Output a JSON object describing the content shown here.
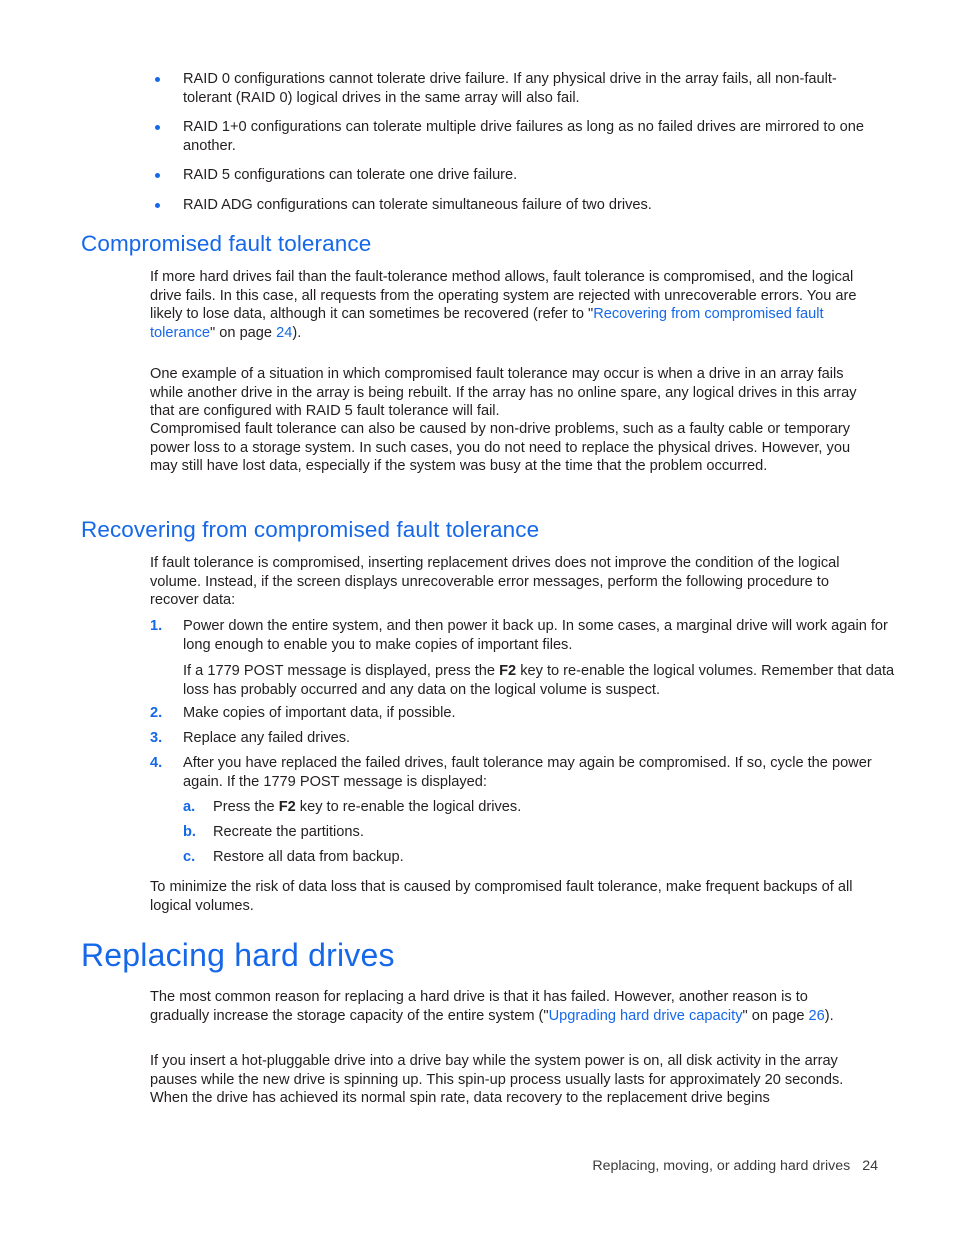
{
  "document": {
    "page_number": "24",
    "footer_chapter": "Replacing, moving, or adding hard drives"
  },
  "bullets": [
    "RAID 0 configurations cannot tolerate drive failure. If any physical drive in the array fails, all non-fault-tolerant (RAID 0) logical drives in the same array will also fail.",
    "RAID 1+0 configurations can tolerate multiple drive failures as long as no failed drives are mirrored to one another.",
    "RAID 5 configurations can tolerate one drive failure.",
    "RAID ADG configurations can tolerate simultaneous failure of two drives."
  ],
  "section_compromised": {
    "heading": "Compromised fault tolerance",
    "para1_a": "If more hard drives fail than the fault-tolerance method allows, fault tolerance is compromised, and the logical drive fails. In this case, all requests from the operating system are rejected with unrecoverable errors. You are likely to lose data, although it can sometimes be recovered (refer to \"",
    "para1_link": "Recovering from compromised fault tolerance",
    "para1_b": "\" on page ",
    "para1_page": "24",
    "para1_c": ").",
    "para2": "One example of a situation in which compromised fault tolerance may occur is when a drive in an array fails while another drive in the array is being rebuilt. If the array has no online spare, any logical drives in this array that are configured with RAID 5 fault tolerance will fail.",
    "para3": "Compromised fault tolerance can also be caused by non-drive problems, such as a faulty cable or temporary power loss to a storage system. In such cases, you do not need to replace the physical drives. However, you may still have lost data, especially if the system was busy at the time that the problem occurred."
  },
  "section_recovering": {
    "heading": "Recovering from compromised fault tolerance",
    "intro": "If fault tolerance is compromised, inserting replacement drives does not improve the condition of the logical volume. Instead, if the screen displays unrecoverable error messages, perform the following procedure to recover data:",
    "steps": [
      {
        "marker": "1.",
        "text": "Power down the entire system, and then power it back up. In some cases, a marginal drive will work again for long enough to enable you to make copies of important files."
      },
      {
        "marker": "2.",
        "text": "Make copies of important data, if possible."
      },
      {
        "marker": "3.",
        "text": "Replace any failed drives."
      },
      {
        "marker": "4.",
        "text": "After you have replaced the failed drives, fault tolerance may again be compromised. If so, cycle the power again. If the 1779 POST message is displayed:"
      }
    ],
    "step1_note_a": "If a 1779 POST message is displayed, press the ",
    "step1_note_key": "F2",
    "step1_note_b": " key to re-enable the logical volumes. Remember that data loss has probably occurred and any data on the logical volume is suspect.",
    "substeps": [
      {
        "marker": "a.",
        "text_a": "Press the ",
        "key": "F2",
        "text_b": " key to re-enable the logical drives."
      },
      {
        "marker": "b.",
        "text_a": "Recreate the partitions.",
        "key": "",
        "text_b": ""
      },
      {
        "marker": "c.",
        "text_a": "Restore all data from backup.",
        "key": "",
        "text_b": ""
      }
    ],
    "closing": "To minimize the risk of data loss that is caused by compromised fault tolerance, make frequent backups of all logical volumes."
  },
  "section_replacing": {
    "heading": "Replacing hard drives",
    "para1_a": "The most common reason for replacing a hard drive is that it has failed. However, another reason is to gradually increase the storage capacity of the entire system (\"",
    "para1_link": "Upgrading hard drive capacity",
    "para1_b": "\" on page ",
    "para1_page": "26",
    "para1_c": ").",
    "para2": "If you insert a hot-pluggable drive into a drive bay while the system power is on, all disk activity in the array pauses while the new drive is spinning up. This spin-up process usually lasts for approximately 20 seconds. When the drive has achieved its normal spin rate, data recovery to the replacement drive begins"
  },
  "colors": {
    "heading_blue": "#1668e8",
    "link_blue": "#1668e8",
    "body_black": "#231f20"
  }
}
